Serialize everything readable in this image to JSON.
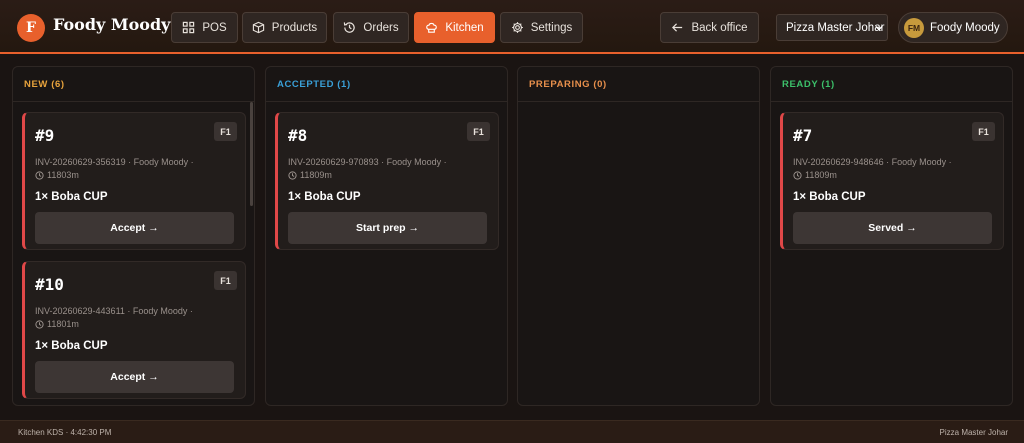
{
  "brand": {
    "logo_letter": "F",
    "name": "Foody Moody",
    "accent": "#e8602c"
  },
  "nav": {
    "pos": "POS",
    "products": "Products",
    "orders": "Orders",
    "kitchen": "Kitchen",
    "settings": "Settings",
    "back_office": "Back office",
    "active": "kitchen"
  },
  "store_selector": {
    "selected": "Pizza Master Johar"
  },
  "user": {
    "initials": "FM",
    "name": "Foody Moody"
  },
  "columns": {
    "new": {
      "title": "NEW (6)",
      "cards": [
        {
          "number": "#9",
          "tag": "F1",
          "invoice": "INV-20260629-356319 · Foody Moody ·",
          "elapsed": "11803m",
          "item": "1× Boba CUP",
          "action": "Accept →"
        },
        {
          "number": "#10",
          "tag": "F1",
          "invoice": "INV-20260629-443611 · Foody Moody ·",
          "elapsed": "11801m",
          "item": "1× Boba CUP",
          "action": "Accept →"
        }
      ]
    },
    "accepted": {
      "title": "ACCEPTED (1)",
      "cards": [
        {
          "number": "#8",
          "tag": "F1",
          "invoice": "INV-20260629-970893 · Foody Moody ·",
          "elapsed": "11809m",
          "item": "1× Boba CUP",
          "action": "Start prep →"
        }
      ]
    },
    "preparing": {
      "title": "PREPARING (0)",
      "cards": []
    },
    "ready": {
      "title": "READY (1)",
      "cards": [
        {
          "number": "#7",
          "tag": "F1",
          "invoice": "INV-20260629-948646 · Foody Moody ·",
          "elapsed": "11809m",
          "item": "1× Boba CUP",
          "action": "Served →"
        }
      ]
    }
  },
  "footer": {
    "left": "Kitchen KDS · 4:42:30 PM",
    "right": "Pizza Master Johar"
  }
}
